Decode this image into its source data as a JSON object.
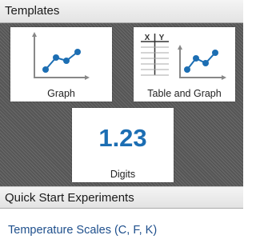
{
  "templates": {
    "header": "Templates",
    "tiles": [
      {
        "label": "Graph",
        "icon": "line-graph-icon"
      },
      {
        "label": "Table and Graph",
        "icon": "table-graph-icon",
        "table_columns": [
          "X",
          "Y"
        ]
      },
      {
        "label": "Digits",
        "icon": "digits-icon",
        "value": "1.23"
      }
    ]
  },
  "quick_start": {
    "header": "Quick Start Experiments",
    "items": [
      {
        "label": "Temperature Scales (C, F, K)"
      }
    ]
  },
  "colors": {
    "accent_blue": "#1c6eb3",
    "link_blue": "#1e4f8c",
    "axis_gray": "#888888"
  }
}
